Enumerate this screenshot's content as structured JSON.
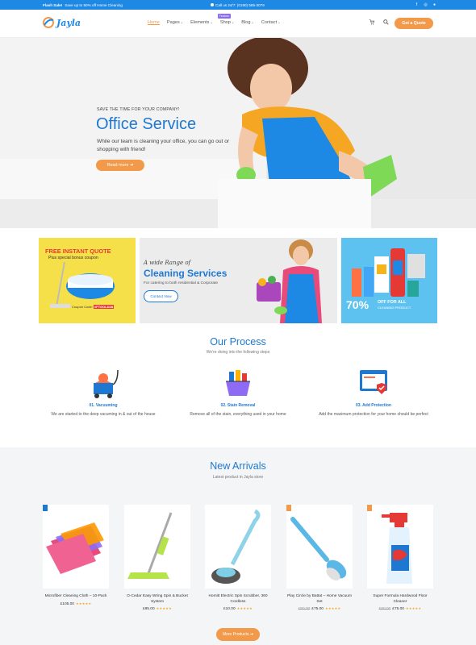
{
  "topbar": {
    "promo_bold": "Flash Sale!",
    "promo_text": "Save up to 50% off Home Cleaning",
    "phone": "Call us 24/7: (0190) 585-3079",
    "social_icons": [
      "facebook-icon",
      "instagram-icon",
      "pinterest-icon"
    ]
  },
  "header": {
    "logo": "Jayla",
    "nav": [
      {
        "label": "Home"
      },
      {
        "label": "Pages"
      },
      {
        "label": "Elements"
      },
      {
        "label": "Shop",
        "badge": "Feature"
      },
      {
        "label": "Blog"
      },
      {
        "label": "Contact"
      }
    ],
    "cta": "Get a Quote"
  },
  "hero": {
    "kicker": "SAVE THE TIME FOR YOUR COMPANY!",
    "title": "Office Service",
    "desc": "While our team is cleaning your office, you can go out or shopping with friend!",
    "button": "Read more"
  },
  "promos": {
    "quote_title": "FREE INSTANT QUOTE",
    "quote_sub": "Plus special bonus coupon",
    "coupon_label": "Coupon Code:",
    "coupon_code": "#FTGOLD28",
    "range_kicker": "A wide Range of",
    "range_title": "Cleaning Services",
    "range_desc": "For catering to both residential & Corporate",
    "contact_btn": "Contact Now",
    "off_pct": "70%",
    "off_text": "OFF FOR ALL",
    "off_sub": "CLEANING PRODUCT"
  },
  "process": {
    "title": "Our Process",
    "sub": "We're doing into the following steps",
    "steps": [
      {
        "title": "01. Vacuuming",
        "desc": "We are started to the deep vacuming in & out of the house"
      },
      {
        "title": "02. Stain Removal",
        "desc": "Remove all of the stain, everything used in your home"
      },
      {
        "title": "03. Add Protection",
        "desc": "Add the maximum protection for your home should be perfect"
      }
    ]
  },
  "arrivals": {
    "title": "New Arrivals",
    "sub": "Latest product in Jayla store",
    "products": [
      {
        "name": "Microfiber Cleaning Cloth – 10-Pack",
        "old": "",
        "price": "£105.00",
        "stars": "★★★★★"
      },
      {
        "name": "O-Cedar Easy Wring Spin & Bucket System",
        "old": "",
        "price": "£85.00",
        "stars": "★★★★★"
      },
      {
        "name": "Homitt Electric Spin Scrubber, 360 Cordless",
        "old": "",
        "price": "£10.00",
        "stars": "★★★★★"
      },
      {
        "name": "Play Circle by Battat – Home Vacuum Set",
        "old": "£80.00",
        "price": "£75.00",
        "stars": "★★★★★"
      },
      {
        "name": "Super Formula Hardwood Floor Cleaner",
        "old": "£80.00",
        "price": "£75.00",
        "stars": "★★★★★"
      }
    ],
    "more": "More Products"
  },
  "colors": {
    "primary": "#1e78d2",
    "accent": "#f2994a",
    "topbar": "#1e88e5"
  }
}
